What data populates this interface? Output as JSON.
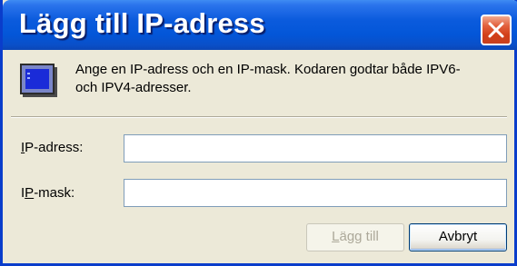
{
  "window": {
    "title": "Lägg till IP-adress"
  },
  "icons": {
    "close": "close-icon",
    "monitor": "monitor-icon"
  },
  "info": {
    "line1": "Ange en IP-adress och en IP-mask. Kodaren godtar både IPV6-",
    "line2": "och IPV4-adresser."
  },
  "fields": {
    "ip_address": {
      "label_accel": "I",
      "label_rest": "P-adress:",
      "value": ""
    },
    "ip_mask": {
      "label_pre": "I",
      "label_accel": "P",
      "label_rest": "-mask:",
      "value": ""
    }
  },
  "buttons": {
    "add_accel": "L",
    "add_rest": "ägg till",
    "add_enabled": false,
    "cancel": "Avbryt"
  },
  "colors": {
    "titlebar": "#0B5BDD",
    "dialog_bg": "#ECE9D8",
    "close": "#D23E17"
  }
}
